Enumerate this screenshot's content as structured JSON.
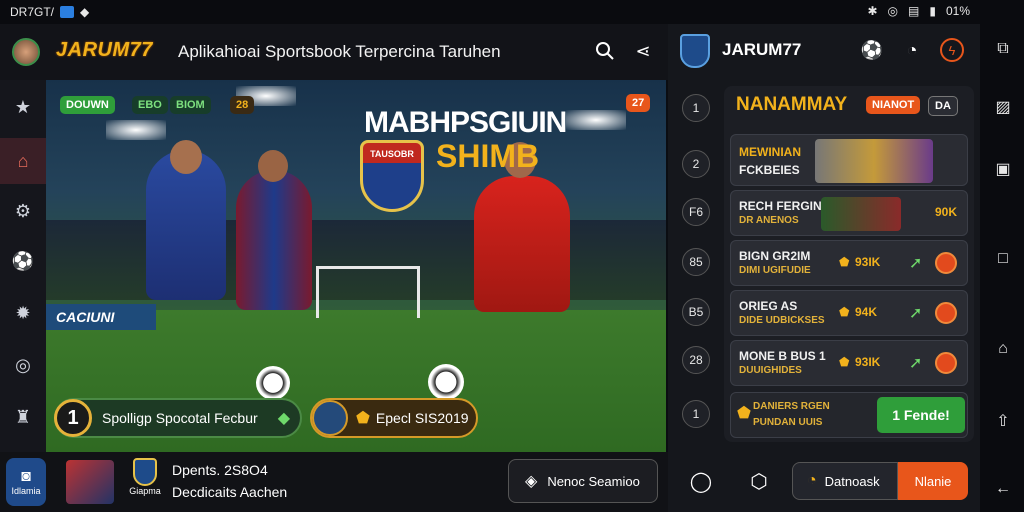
{
  "status_bar": {
    "time": "DR7GT/",
    "battery": "01%"
  },
  "app": {
    "logo": "JARUM77",
    "title": "Aplikahioai Sportsbook Terpercina Taruhen"
  },
  "hero": {
    "badges": [
      "DOUWN",
      "EBO",
      "BIOM",
      "28"
    ],
    "corner_badge": "27",
    "headline_1": "MABHPSGIUIN",
    "headline_2": "SHIMB",
    "shield_text": "TAUSOBR",
    "sign_text": "CACIUNI",
    "button_left_num": "1",
    "button_left_label": "Spolligp Spocotal Fecbur",
    "button_right_label": "Epecl SIS2019"
  },
  "bottom": {
    "home_label": "Idlamia",
    "badge_label": "Giapma",
    "line1": "Dpents. 2S8O4",
    "line2": "Decdicaits Aachen",
    "search_button": "Nenoc Seamioo"
  },
  "right": {
    "logo": "JARUM77",
    "header_title": "NANAMMAY",
    "header_btn_orange": "NIANOT",
    "header_btn_dark": "DA",
    "row_numbers": [
      "1",
      "2",
      "F6",
      "85",
      "B5",
      "28",
      "1"
    ],
    "rows": [
      {
        "title": "MEWINIAN",
        "sub": "FCKBEIES"
      },
      {
        "title": "RECH FERGIN",
        "sub": "DR ANENOS",
        "value": "90K"
      },
      {
        "title": "BIGN GR2IM",
        "sub": "DIMI UGIFUDIE",
        "value": "93IK"
      },
      {
        "title": "ORIEG AS",
        "sub": "DIDE UDBICKSES",
        "value": "94K"
      },
      {
        "title": "MONE B BUS 1",
        "sub": "DUUIGHIDES",
        "value": "93IK"
      },
      {
        "title": "DANIERS RGEN",
        "sub": "PUNDAN UUIS",
        "button": "1 Fende!"
      }
    ],
    "bottom_btn_dark": "Datnoask",
    "bottom_btn_orange": "Nlanie"
  },
  "colors": {
    "accent": "#f2b21c",
    "orange": "#e8561b",
    "green": "#2f9e3a"
  }
}
